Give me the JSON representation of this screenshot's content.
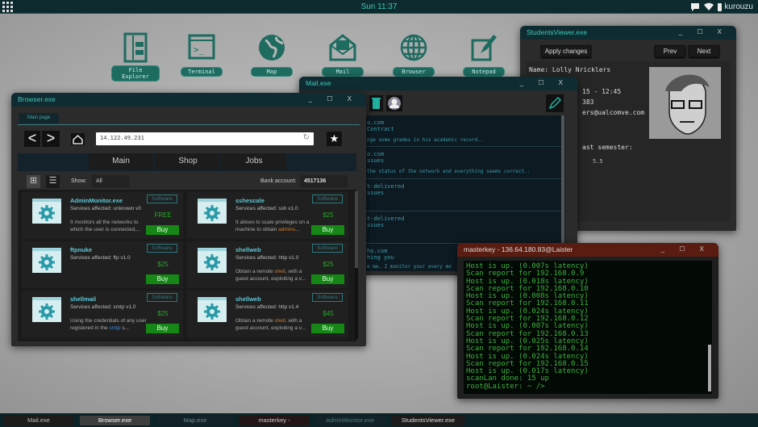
{
  "topbar": {
    "clock": "Sun 11:37",
    "user": "kurouzu",
    "icons": [
      "apps-grid-icon",
      "chat-icon",
      "wifi-icon",
      "battery-icon"
    ]
  },
  "desktop": [
    {
      "label": "File Explorer",
      "icon": "file-explorer-icon"
    },
    {
      "label": "Terminal",
      "icon": "terminal-icon"
    },
    {
      "label": "Map",
      "icon": "globe-map-icon"
    },
    {
      "label": "Mail",
      "icon": "mail-icon"
    },
    {
      "label": "Browser",
      "icon": "browser-globe-icon"
    },
    {
      "label": "Notepad",
      "icon": "notepad-pencil-icon"
    }
  ],
  "students": {
    "title": "StudentsViewer.exe",
    "apply": "Apply changes",
    "prev": "Prev",
    "next": "Next",
    "lines": [
      "Name: Lolly Nricklers",
      "15 - 12:45",
      "383",
      "ers@ualcomve.com",
      "ast semester:",
      "5.5"
    ]
  },
  "mail": {
    "title": "Mail.exe",
    "items": [
      [
        "o.com",
        "Contract",
        "nge some grades in his academic record.."
      ],
      [
        "o.com",
        "ssues",
        "the status of the network and everything seems correct.."
      ],
      [
        "t-delivered",
        "ssues",
        ""
      ],
      [
        "t-delivered",
        "ssues",
        ""
      ],
      [
        "ho.com",
        "hing you",
        "e me. I monitor your every mo"
      ]
    ]
  },
  "browser": {
    "title": "Browser.exe",
    "tab": "Main page",
    "url": "14.122.49.231",
    "nav": [
      "Main",
      "Shop",
      "Jobs"
    ],
    "show_label": "Show:",
    "show_value": "All",
    "bank_label": "Bank account:",
    "bank_value": "4517136",
    "cards": [
      {
        "name": "AdminMonitor.exe",
        "svc": "Services affected: unknown v0",
        "desc": "It monitors all the networks to which the user is connected,...",
        "badge": "Software",
        "price": "FREE",
        "buy": "Buy"
      },
      {
        "name": "sshescale",
        "svc": "Services affected: ssh v1.0",
        "desc_a": "It allows to scale privileges on a machine to obtain ",
        "desc_hl": "admins",
        "desc_b": "...",
        "badge": "Software",
        "price": "$25",
        "buy": "Buy"
      },
      {
        "name": "ftpnuke",
        "svc": "Services affected: ftp v1.0",
        "desc": "",
        "badge": "Software",
        "price": "$25",
        "buy": "Buy"
      },
      {
        "name": "shellweb",
        "svc": "Services affected: http v1.0",
        "desc_a": "Obtain a remote ",
        "desc_hl": "shell",
        "desc_b": ", with a guest account, exploiting a v...",
        "badge": "Software",
        "price": "$25",
        "buy": "Buy"
      },
      {
        "name": "shellmail",
        "svc": "Services affected: smtp v1.0",
        "desc_a": "Using the credentials of any user registered in the ",
        "desc_hl": "smtp",
        "desc_b": " s...",
        "badge": "Software",
        "price": "$25",
        "buy": "Buy"
      },
      {
        "name": "shellweb",
        "svc": "Services affected: http v1.4",
        "desc_a": "Obtain a remote ",
        "desc_hl": "shell",
        "desc_b": ", with a guest account, exploiting a v...",
        "badge": "Software",
        "price": "$45",
        "buy": "Buy"
      }
    ]
  },
  "terminal": {
    "title": "masterkey - 136.64.180.83@Laister",
    "lines": [
      "Host is up. (0.007s latency)",
      "Scan report for 192.168.0.9",
      "Host is up. (0.018s latency)",
      "Scan report for 192.168.0.10",
      "Host is up. (0.008s latency)",
      "Scan report for 192.168.0.11",
      "Host is up. (0.024s latency)",
      "Scan report for 192.168.0.12",
      "Host is up. (0.007s latency)",
      "Scan report for 192.168.0.13",
      "Host is up. (0.025s latency)",
      "Scan report for 192.168.0.14",
      "Host is up. (0.024s latency)",
      "Scan report for 192.168.0.15",
      "Host is up. (0.017s latency)",
      "scanLan done: 15 up",
      "root@Laister: ~ />"
    ]
  },
  "taskbar": [
    "Mail.exe",
    "Browser.exe",
    "Map.exe",
    "masterkey -",
    "AdminMonitor.exe",
    "StudentsViewer.exe"
  ]
}
